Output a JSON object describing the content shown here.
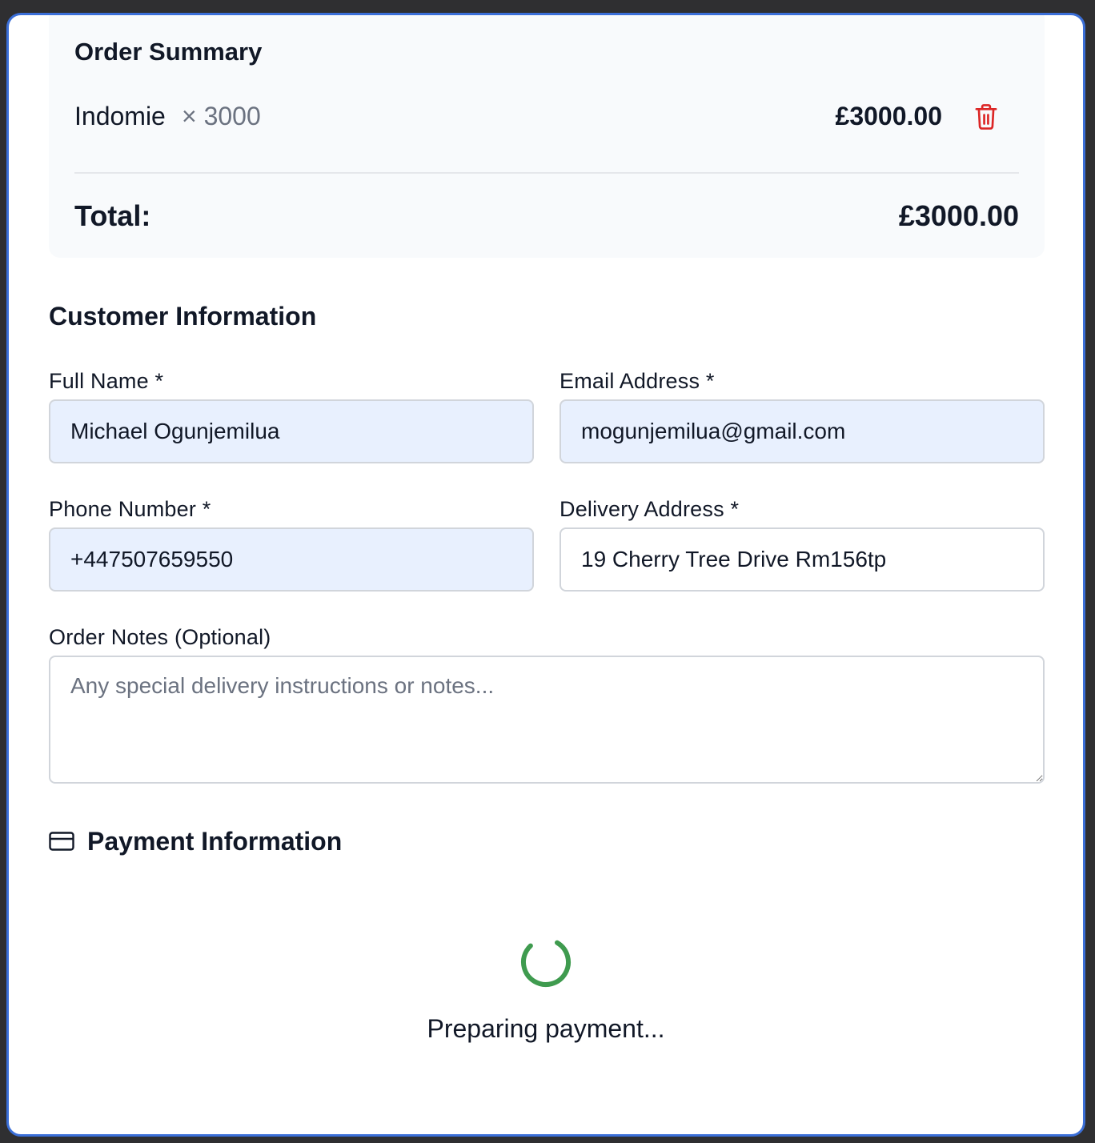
{
  "order_summary": {
    "title": "Order Summary",
    "items": [
      {
        "name": "Indomie",
        "quantity": "× 3000",
        "price": "£3000.00"
      }
    ],
    "total_label": "Total:",
    "total_value": "£3000.00",
    "delete_icon": "trash-icon",
    "delete_color": "#dc2626"
  },
  "customer": {
    "title": "Customer Information",
    "full_name": {
      "label": "Full Name *",
      "value": "Michael Ogunjemilua"
    },
    "email": {
      "label": "Email Address *",
      "value": "mogunjemilua@gmail.com"
    },
    "phone": {
      "label": "Phone Number *",
      "value": "+447507659550"
    },
    "address": {
      "label": "Delivery Address *",
      "value": "19 Cherry Tree Drive Rm156tp"
    },
    "notes": {
      "label": "Order Notes (Optional)",
      "value": "",
      "placeholder": "Any special delivery instructions or notes..."
    }
  },
  "payment": {
    "title": "Payment Information",
    "icon": "credit-card-icon",
    "loading_text": "Preparing payment...",
    "spinner_color": "#3f9b4f"
  },
  "colors": {
    "autofill_bg": "#e8f0fe",
    "modal_border": "#3b6fd8"
  }
}
